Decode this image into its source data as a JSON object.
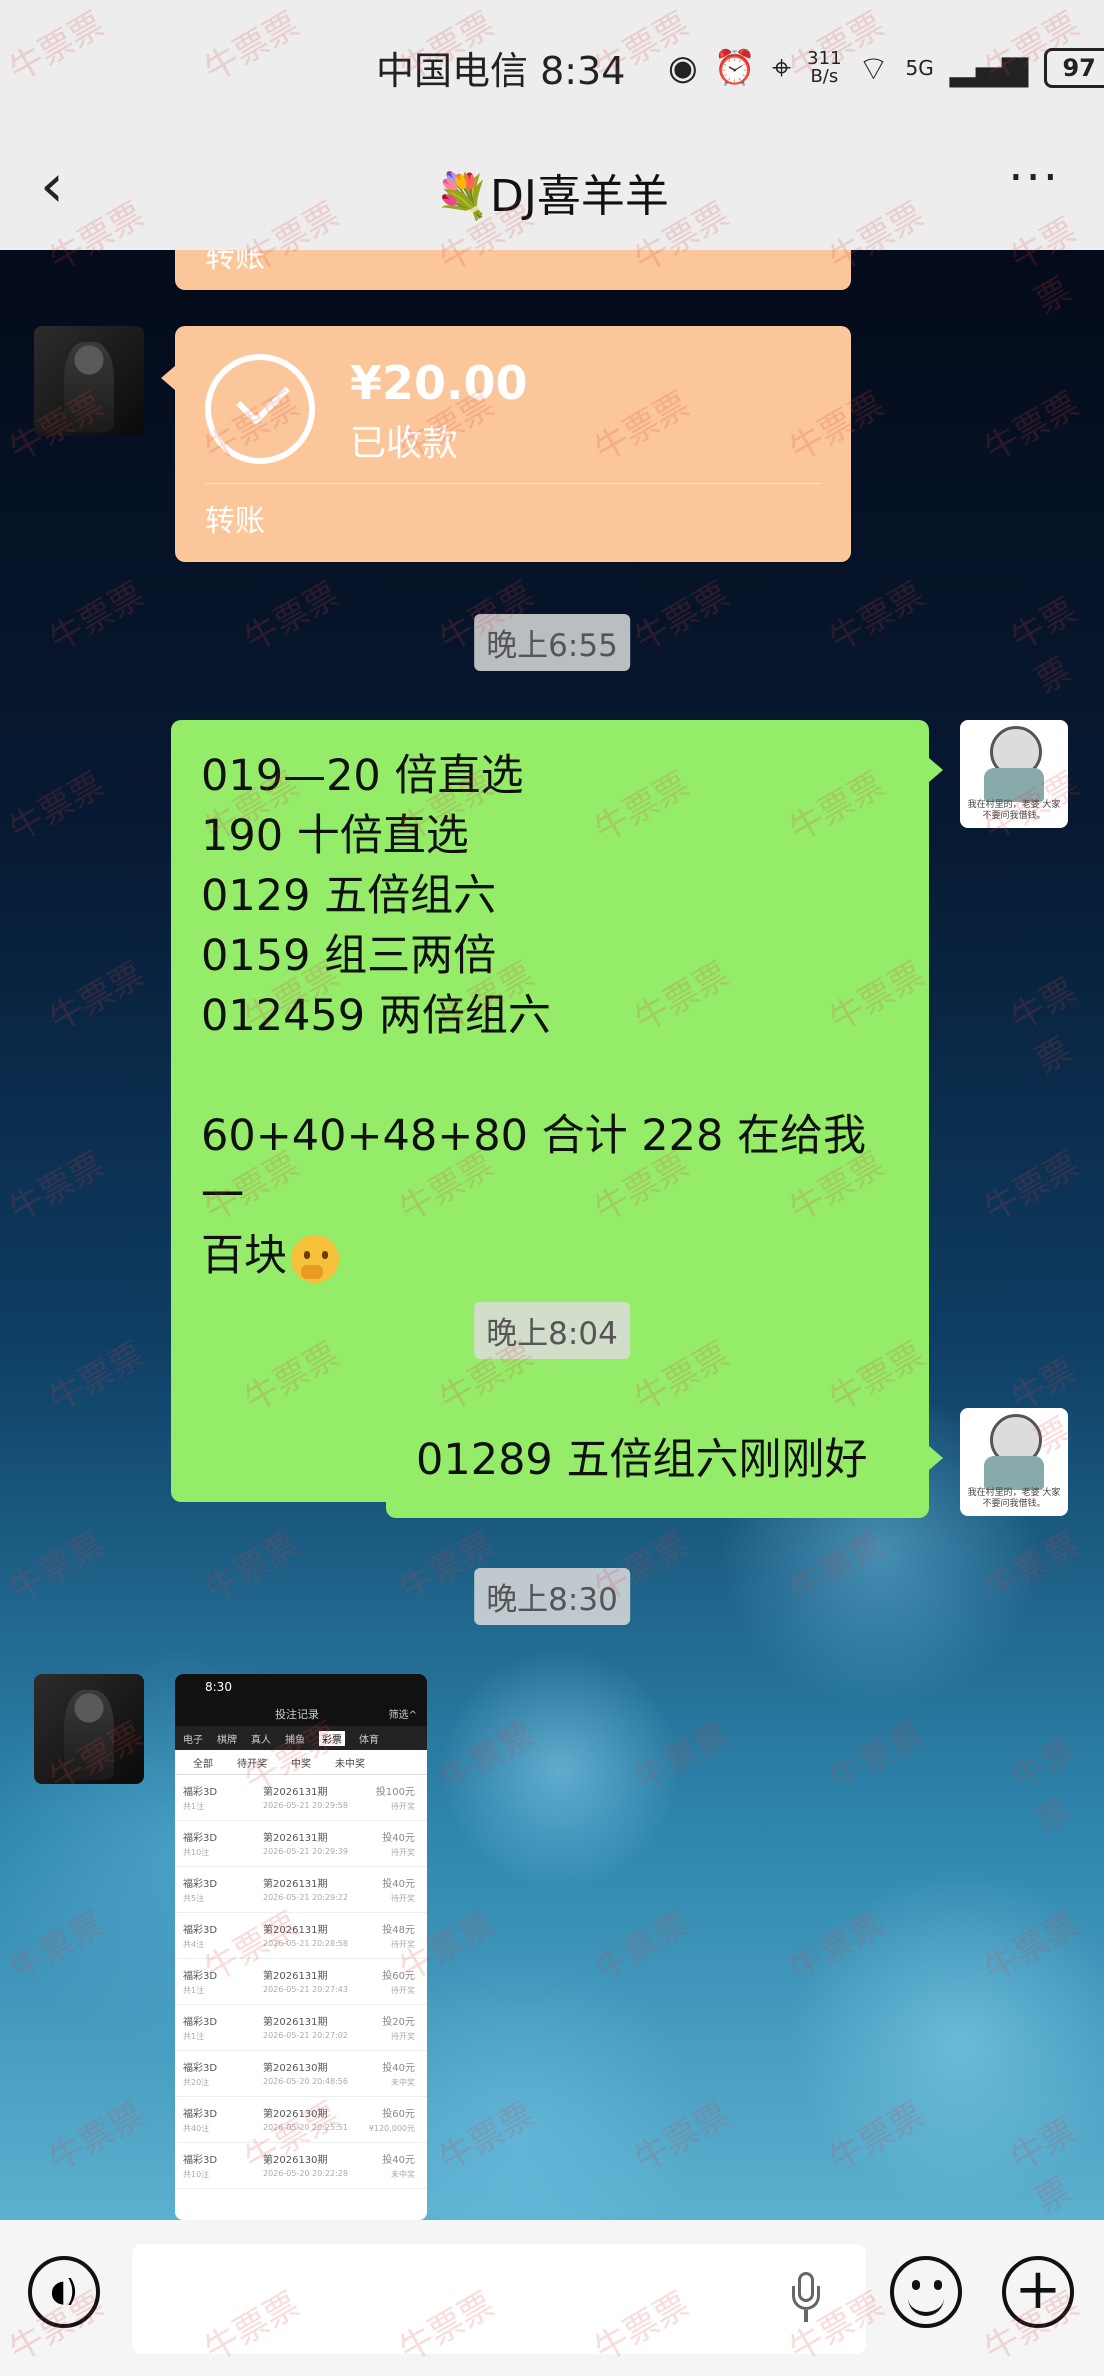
{
  "status_bar": {
    "carrier_time": "中国电信 8:34",
    "net_speed_value": "311",
    "net_speed_unit": "B/s",
    "signal_label": "5G",
    "battery": "97",
    "icons": [
      "eye-icon",
      "alarm-icon",
      "location-icon",
      "wifi-icon",
      "signal-icon",
      "battery-icon"
    ]
  },
  "header": {
    "title": "💐DJ喜羊羊",
    "back_icon": "chevron-left-icon",
    "more_icon": "more-dots-icon",
    "more_label": "···"
  },
  "transfer_top_partial": {
    "label": "转账"
  },
  "transfer": {
    "amount": "¥20.00",
    "status": "已收款",
    "label": "转账"
  },
  "time_1": "晚上6:55",
  "message_1": {
    "lines": [
      "019—20 倍直选",
      "190 十倍直选",
      "0129 五倍组六",
      "0159 组三两倍",
      "012459 两倍组六",
      "",
      "60+40+48+80 合计 228 在给我一",
      "百块"
    ]
  },
  "time_2": "晚上8:04",
  "message_2": {
    "text": "01289 五倍组六刚刚好"
  },
  "time_3": "晚上8:30",
  "image_message": {
    "time": "8:30",
    "title": "投注记录",
    "filter": "筛选^",
    "tabs": [
      "电子",
      "棋牌",
      "真人",
      "捕鱼",
      "彩票",
      "体育"
    ],
    "active_tab": "彩票",
    "subtabs": [
      "全部",
      "待开奖",
      "中奖",
      "未中奖"
    ],
    "rows": [
      {
        "game": "福彩3D",
        "issue": "第2026131期",
        "amount": "投100元",
        "sub1": "共1注",
        "date": "2026-05-21 20:29:58",
        "result": "待开奖"
      },
      {
        "game": "福彩3D",
        "issue": "第2026131期",
        "amount": "投40元",
        "sub1": "共10注",
        "date": "2026-05-21 20:29:39",
        "result": "待开奖"
      },
      {
        "game": "福彩3D",
        "issue": "第2026131期",
        "amount": "投40元",
        "sub1": "共5注",
        "date": "2026-05-21 20:29:22",
        "result": "待开奖"
      },
      {
        "game": "福彩3D",
        "issue": "第2026131期",
        "amount": "投48元",
        "sub1": "共4注",
        "date": "2026-05-21 20:28:58",
        "result": "待开奖"
      },
      {
        "game": "福彩3D",
        "issue": "第2026131期",
        "amount": "投60元",
        "sub1": "共1注",
        "date": "2026-05-21 20:27:43",
        "result": "待开奖"
      },
      {
        "game": "福彩3D",
        "issue": "第2026131期",
        "amount": "投20元",
        "sub1": "共1注",
        "date": "2026-05-21 20:27:02",
        "result": "待开奖"
      },
      {
        "game": "福彩3D",
        "issue": "第2026130期",
        "amount": "投40元",
        "sub1": "共20注",
        "date": "2026-05-20 20:48:56",
        "result": "未中奖"
      },
      {
        "game": "福彩3D",
        "issue": "第2026130期",
        "amount": "投60元",
        "sub1": "共40注",
        "date": "2026-05-20 20:25:51",
        "result": "¥120,000元"
      },
      {
        "game": "福彩3D",
        "issue": "第2026130期",
        "amount": "投40元",
        "sub1": "共10注",
        "date": "2026-05-20 20:22:28",
        "result": "未中奖"
      }
    ]
  },
  "avatar_right_caption": "我在村里的，老婆 大家不要问我借钱。",
  "input_bar": {
    "placeholder": "",
    "icons": [
      "voice-icon",
      "mic-icon",
      "emoji-icon",
      "plus-icon"
    ]
  },
  "watermark_text": "牛票票"
}
